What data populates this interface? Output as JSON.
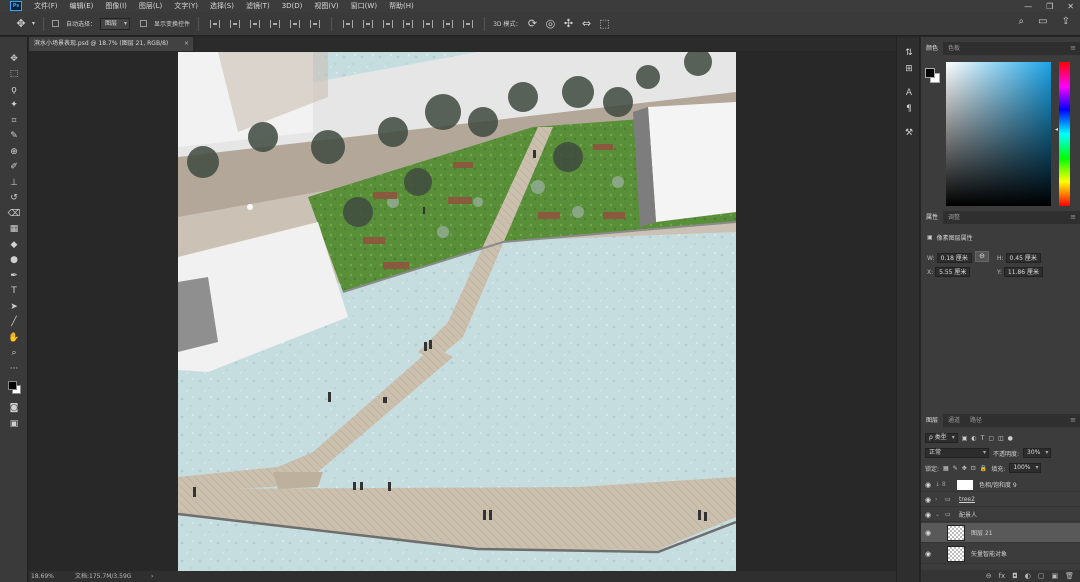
{
  "menubar": {
    "logo": "Ps",
    "items": [
      "文件(F)",
      "编辑(E)",
      "图像(I)",
      "图层(L)",
      "文字(Y)",
      "选择(S)",
      "滤镜(T)",
      "3D(D)",
      "视图(V)",
      "窗口(W)",
      "帮助(H)"
    ],
    "controls": [
      "—",
      "❐",
      "✕"
    ]
  },
  "options": {
    "auto_select_label": "自动选择：",
    "auto_select_value": "图层",
    "show_transform_label": "显示变换控件",
    "mode_label": "3D 模式："
  },
  "document": {
    "tab_title": "滨水小场景表现.psd @ 18.7% (图层 21, RGB/8)",
    "tab_close": "×"
  },
  "status": {
    "zoom": "18.69%",
    "doc_info": "文档:175.7M/3.59G",
    "arrow": "›"
  },
  "color_panel": {
    "tabs": [
      "颜色",
      "色板"
    ],
    "active_tab": 0,
    "hue_marker": "◂",
    "fg": "#000000",
    "bg": "#ffffff",
    "picker_hue": "#1aa3e6"
  },
  "properties": {
    "tabs": [
      "属性",
      "调整"
    ],
    "active_tab": 0,
    "type_label": "像素图层属性",
    "w_label": "W:",
    "w_value": "0.18 厘米",
    "h_label": "H:",
    "h_value": "0.45 厘米",
    "x_label": "X:",
    "x_value": "5.55 厘米",
    "y_label": "Y:",
    "y_value": "11.86 厘米",
    "link_icon": "⊖"
  },
  "layers": {
    "tabs": [
      "图层",
      "通道",
      "路径"
    ],
    "active_tab": 0,
    "filter_value": "ρ 类型",
    "blend_mode": "正常",
    "opacity_label": "不透明度:",
    "opacity_value": "30%",
    "lock_label": "锁定:",
    "fill_label": "填充:",
    "fill_value": "100%",
    "items": [
      {
        "name": "色相/饱和度 9",
        "kind": "adjustment"
      },
      {
        "name": "tree2",
        "kind": "group"
      },
      {
        "name": "配景人",
        "kind": "group-open"
      },
      {
        "name": "图层 21",
        "kind": "pixel",
        "selected": true
      },
      {
        "name": "矢量智能对象",
        "kind": "pixel"
      }
    ],
    "footer": [
      "⊖",
      "fx",
      "◘",
      "◐",
      "▢",
      "▣",
      "🗑"
    ]
  },
  "right_strip": [
    "⇅",
    "⊞",
    "A",
    "¶",
    "⚒"
  ]
}
